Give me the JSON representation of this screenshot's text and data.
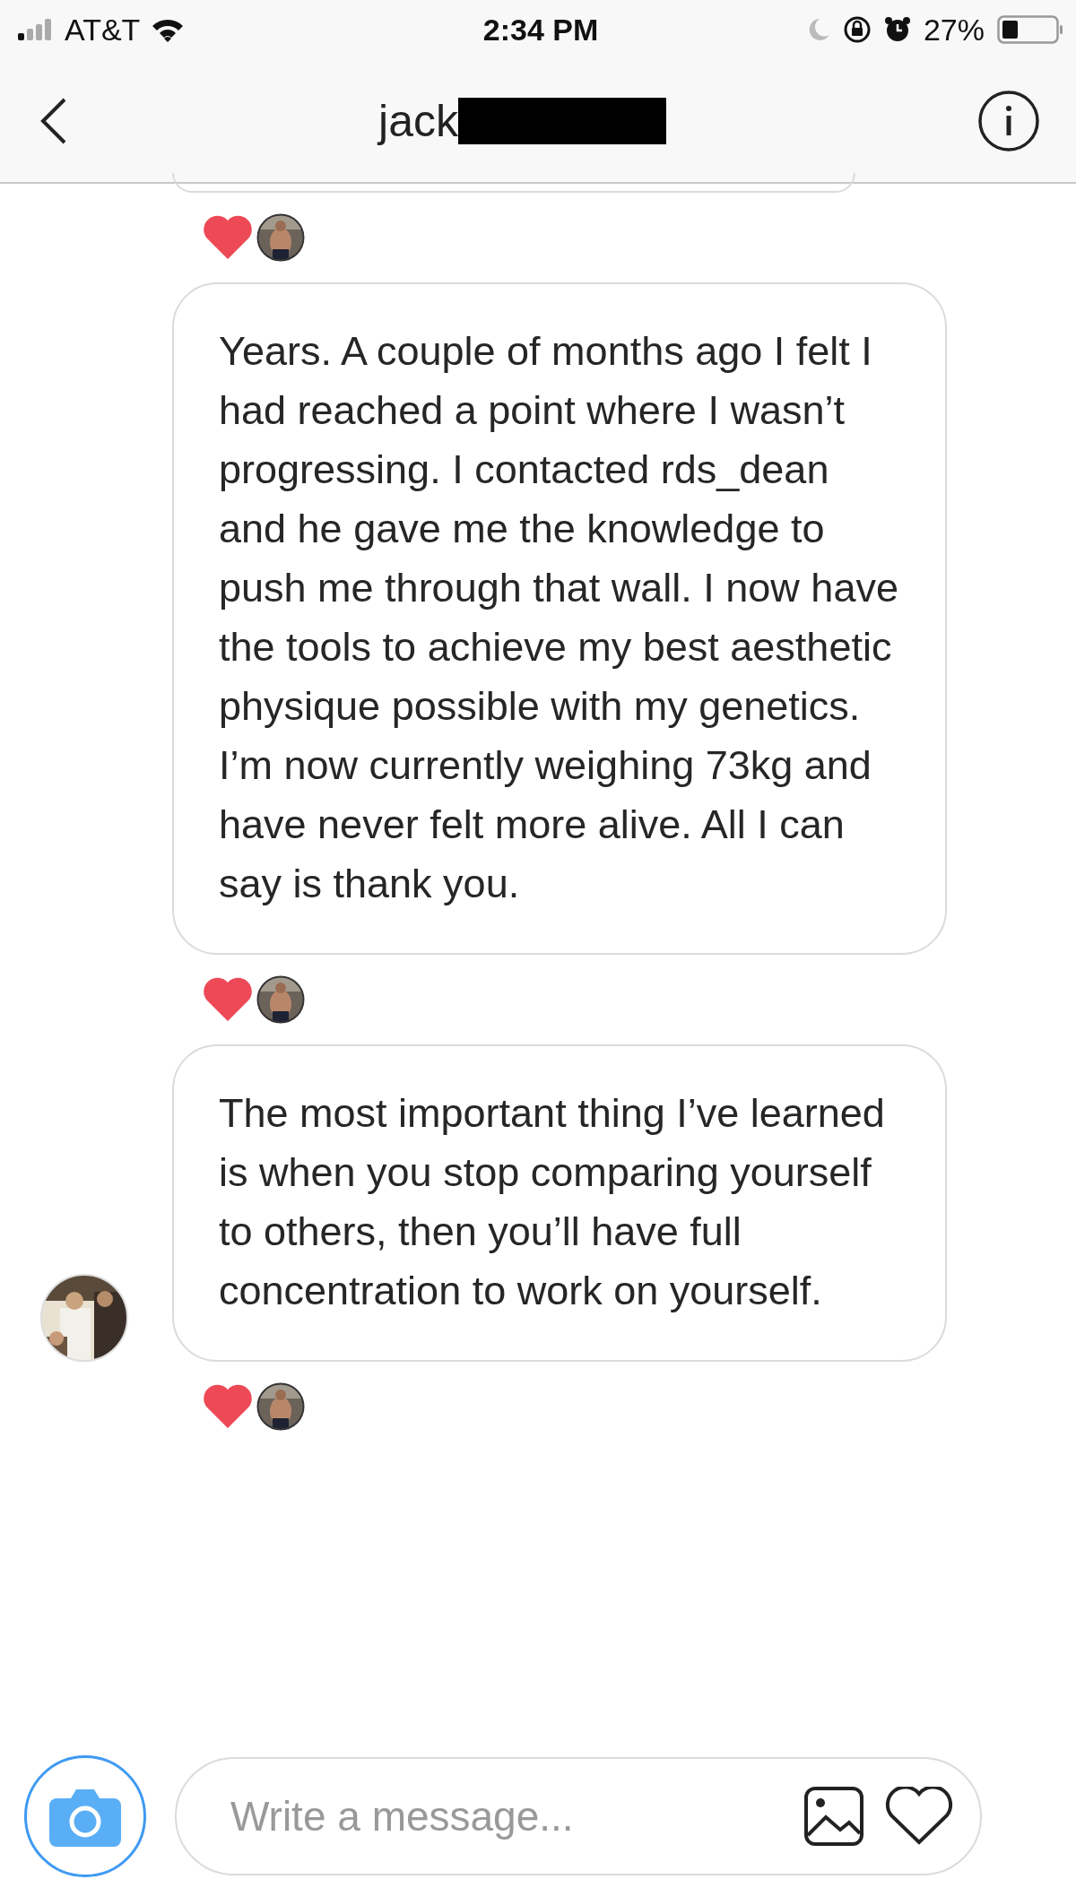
{
  "status_bar": {
    "carrier": "AT&T",
    "time": "2:34 PM",
    "battery": "27%"
  },
  "header": {
    "title": "jack",
    "redacted": true
  },
  "messages": [
    {
      "kind": "clipped",
      "liked": true,
      "show_avatar": false
    },
    {
      "kind": "text",
      "text": "Years. A couple of months ago I felt I had reached a point where I wasn’t progressing. I contacted rds_dean and he gave me the knowledge to push me through that wall. I now have the tools to achieve my best aesthetic physique possible with my genetics. I’m now currently weighing 73kg and have never felt more alive. All I can say is thank you.",
      "liked": true,
      "show_avatar": false
    },
    {
      "kind": "text",
      "text": "The most important thing I’ve learned is when you stop comparing yourself to others, then you’ll have full concentration to work on yourself.",
      "liked": true,
      "show_avatar": true
    }
  ],
  "composer": {
    "placeholder": "Write a message..."
  }
}
